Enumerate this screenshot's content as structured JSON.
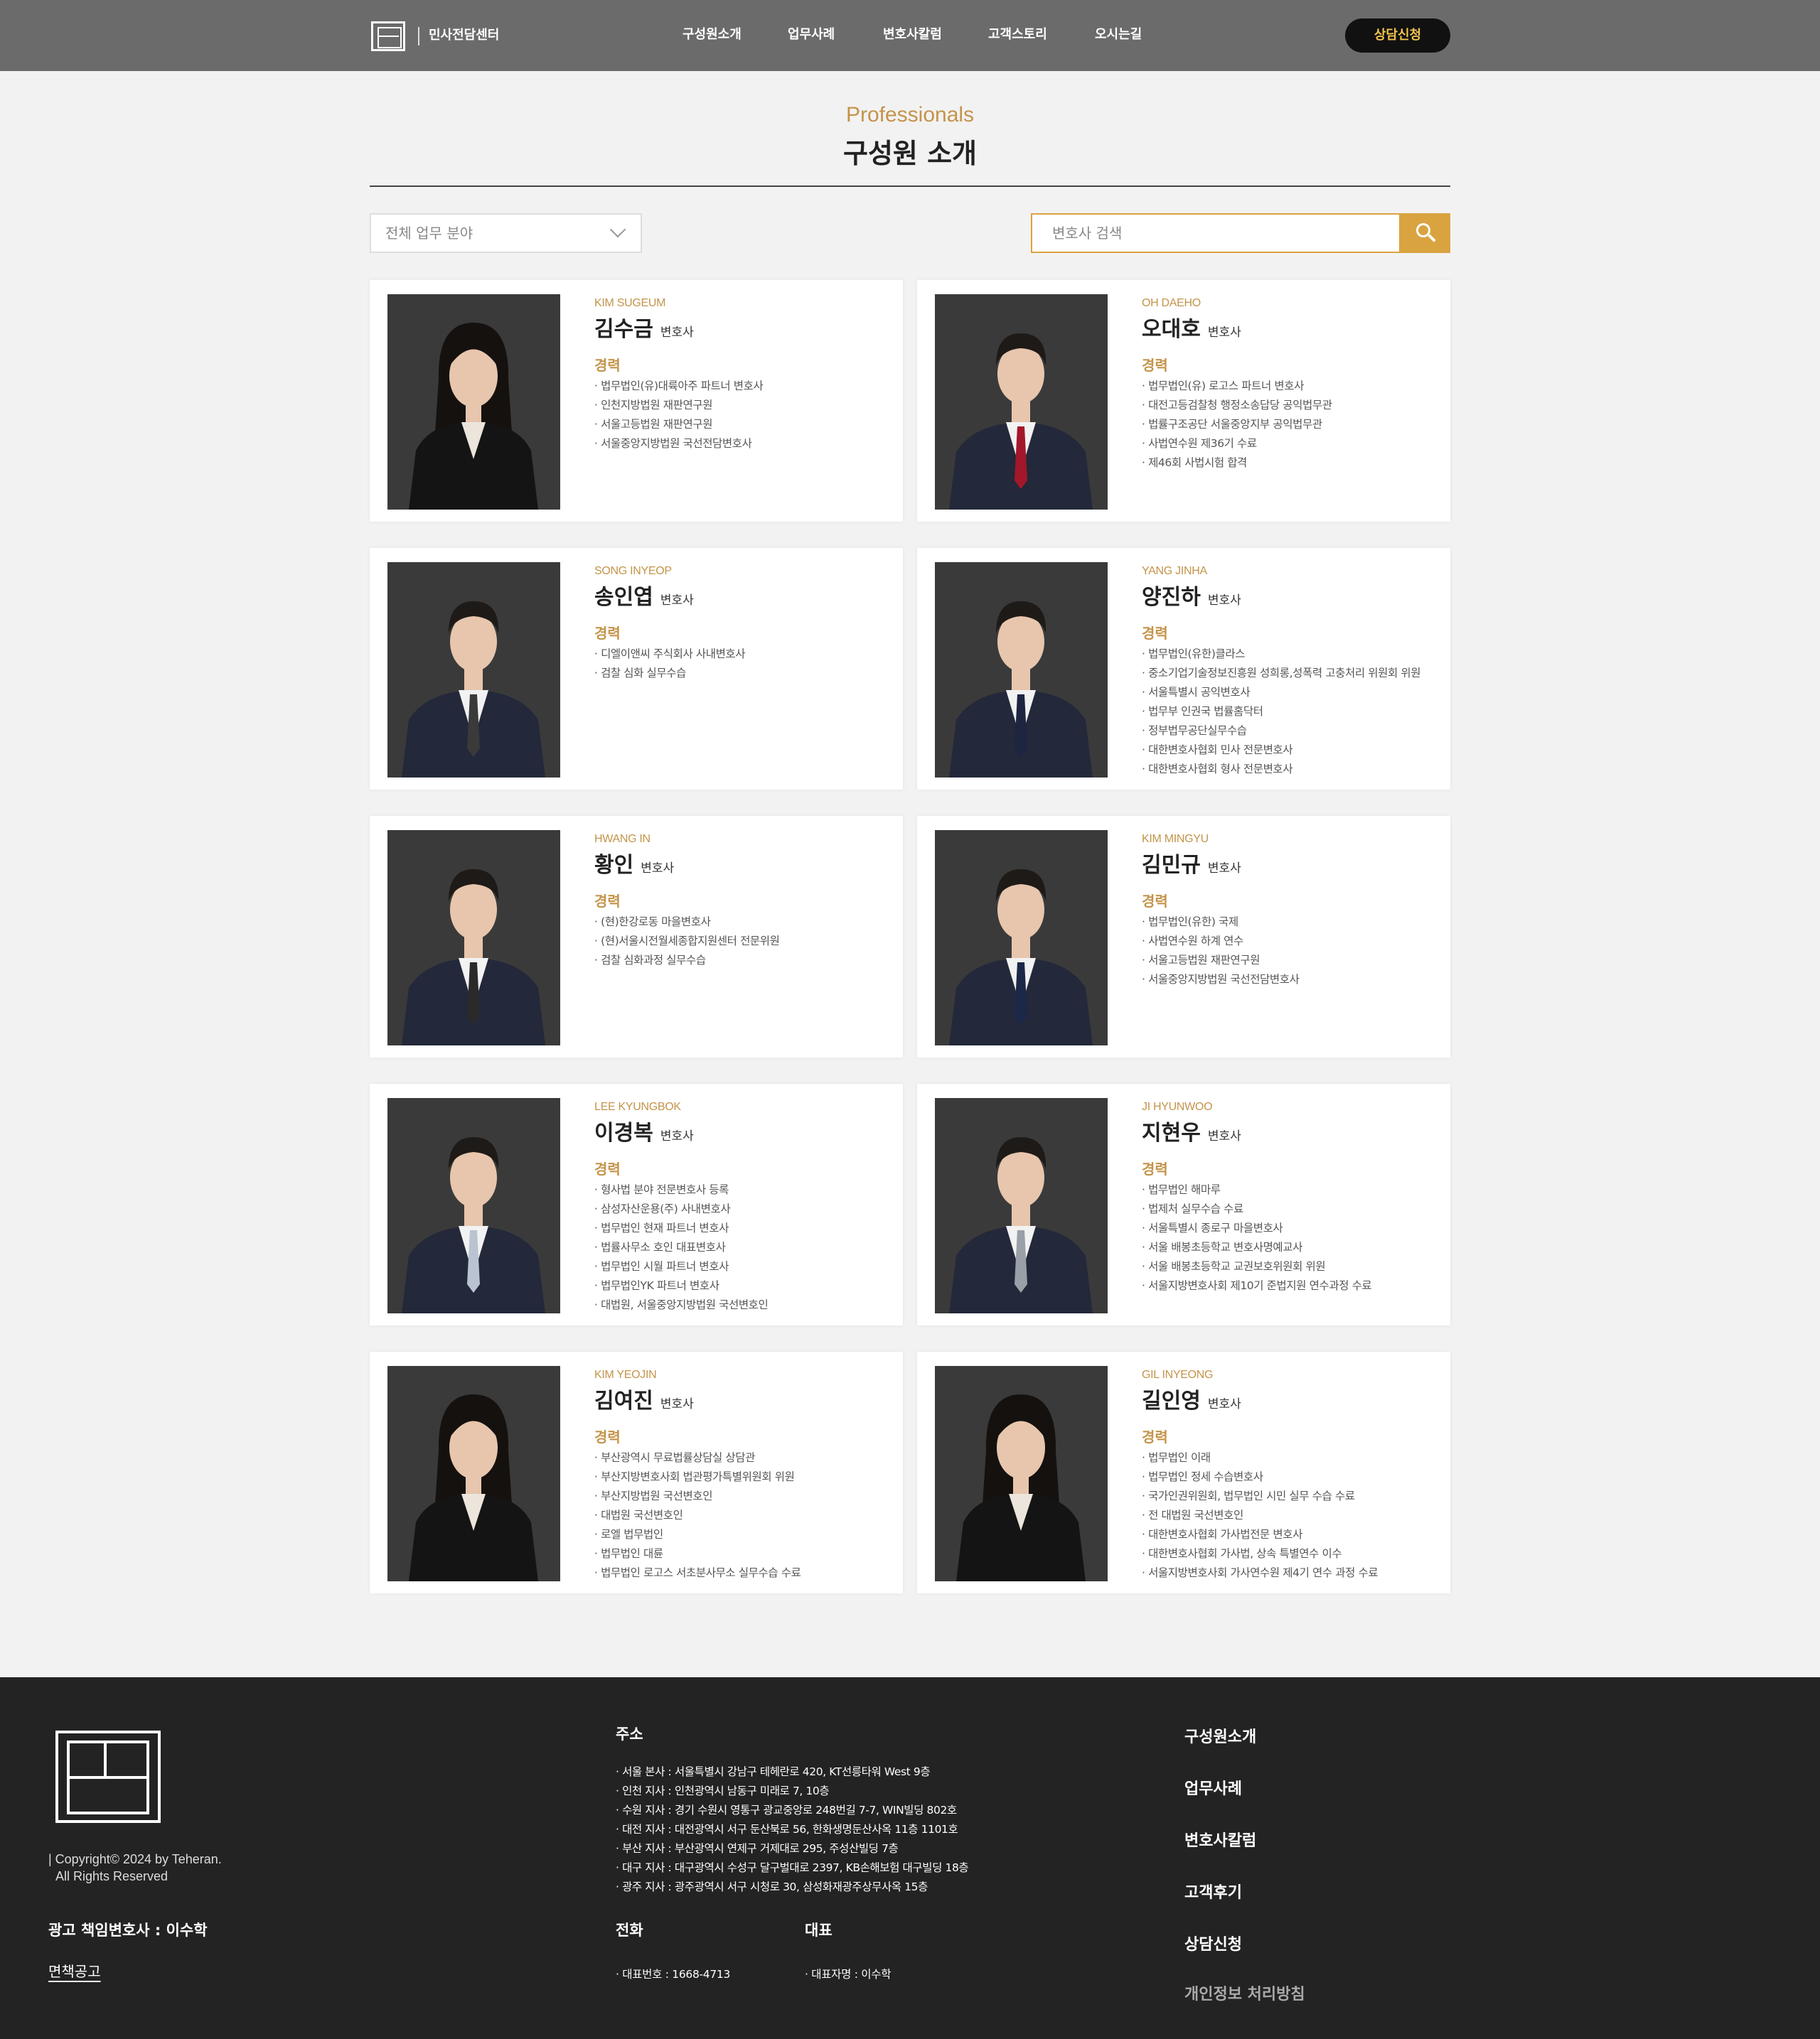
{
  "header": {
    "logo_text": "민사전담센터",
    "nav": [
      "구성원소개",
      "업무사례",
      "변호사칼럼",
      "고객스토리",
      "오시는길"
    ],
    "cta": "상담신청"
  },
  "intro": {
    "eyebrow": "Professionals",
    "title": "구성원 소개"
  },
  "filters": {
    "select_value": "전체 업무 분야",
    "search_placeholder": "변호사 검색"
  },
  "career_label": "경력",
  "role_label": "변호사",
  "lawyers": [
    {
      "eng": "KIM SUGEUM",
      "name": "김수금",
      "gender": "f",
      "tie": "none",
      "career": [
        "법무법인(유)대륙아주 파트너 변호사",
        "인천지방법원 재판연구원",
        "서울고등법원 재판연구원",
        "서울중앙지방법원 국선전담변호사"
      ]
    },
    {
      "eng": "OH DAEHO",
      "name": "오대호",
      "gender": "m",
      "tie": "#a3172a",
      "career": [
        "법무법인(유) 로고스 파트너 변호사",
        "대전고등검찰청 행정소송답당 공익법무관",
        "법률구조공단 서울중앙지부 공익법무관",
        "사법연수원 제36기 수료",
        "제46회 사법시험 합격"
      ]
    },
    {
      "eng": "SONG INYEOP",
      "name": "송인엽",
      "gender": "m",
      "tie": "#3a3a3a",
      "career": [
        "디엘이앤씨 주식회사 사내변호사",
        "검찰 심화 실무수습"
      ]
    },
    {
      "eng": "YANG JINHA",
      "name": "양진하",
      "gender": "m",
      "tie": "#1d2540",
      "career": [
        "법무법인(유한)클라스",
        "중소기업기술정보진흥원 성희롱,성폭력 고충처리 위원회 위원",
        "서울특별시 공익변호사",
        "법무부 인권국 법률홈닥터",
        "정부법무공단실무수습",
        "대한변호사협회 민사 전문변호사",
        "대한변호사협회 형사 전문변호사"
      ]
    },
    {
      "eng": "HWANG IN",
      "name": "황인",
      "gender": "m",
      "tie": "#2a2a2a",
      "career": [
        "(현)한강로동 마을변호사",
        "(현)서울시전월세종합지원센터 전문위원",
        "검찰 심화과정 실무수습"
      ]
    },
    {
      "eng": "KIM MINGYU",
      "name": "김민규",
      "gender": "m",
      "tie": "#1b2848",
      "career": [
        "법무법인(유한) 국제",
        "사법연수원 하계 연수",
        "서울고등법원 재판연구원",
        "서울중앙지방법원 국선전담변호사"
      ]
    },
    {
      "eng": "LEE KYUNGBOK",
      "name": "이경복",
      "gender": "m",
      "tie": "#b9c4d0",
      "career": [
        "형사법 분야 전문변호사 등록",
        "삼성자산운용(주) 사내변호사",
        "법무법인 현재 파트너 변호사",
        "법률사무소 호인 대표변호사",
        "법무법인 시월 파트너 변호사",
        "법무법인YK 파트너 변호사",
        "대법원, 서울중앙지방법원 국선변호인"
      ]
    },
    {
      "eng": "JI HYUNWOO",
      "name": "지현우",
      "gender": "m",
      "tie": "#9aa0a8",
      "career": [
        "법무법인 해마루",
        "법제처 실무수습 수료",
        "서울특별시 종로구 마을변호사",
        "서울 배봉초등학교 변호사명예교사",
        "서울 배봉초등학교 교권보호위원회 위원",
        "서울지방변호사회 제10기 준법지원 연수과정 수료"
      ]
    },
    {
      "eng": "KIM YEOJIN",
      "name": "김여진",
      "gender": "f",
      "tie": "none",
      "career": [
        "부산광역시 무료법률상담실 상담관",
        "부산지방변호사회 법관평가특별위원회 위원",
        "부산지방법원 국선변호인",
        "대법원 국선변호인",
        "로엘 법무법인",
        "법무법인 대륜",
        "법무법인 로고스 서초분사무소 실무수습 수료"
      ]
    },
    {
      "eng": "GIL INYEONG",
      "name": "길인영",
      "gender": "f",
      "tie": "none",
      "career": [
        "법무법인 이래",
        "법무법인 정세 수습변호사",
        "국가인권위원회, 법무법인 시민 실무 수습 수료",
        "전 대법원 국선변호인",
        "대한변호사협회 가사법전문 변호사",
        "대한변호사협회 가사법, 상속 특별연수 이수",
        "서울지방변호사회 가사연수원 제4기 연수 과정 수료"
      ]
    }
  ],
  "footer": {
    "copyright_1": "| Copyright© 2024 by Teheran.",
    "copyright_2": "All Rights Reserved",
    "ad_lawyer": "광고 책임변호사 : 이수학",
    "disclaimer": "면책공고",
    "address_heading": "주소",
    "addresses": [
      "서울 본사 : 서울특별시 강남구 테헤란로 420, KT선릉타워 West 9층",
      "인천 지사 : 인천광역시 남동구 미래로 7, 10층",
      "수원 지사 : 경기 수원시 영통구 광교중앙로 248번길 7-7, WIN빌딩 802호",
      "대전 지사 : 대전광역시 서구 둔산북로 56, 한화생명둔산사옥 11층 1101호",
      "부산 지사 : 부산광역시 연제구 거제대로 295, 주성산빌딩 7층",
      "대구 지사 : 대구광역시 수성구 달구벌대로 2397, KB손해보험 대구빌딩 18층",
      "광주 지사 : 광주광역시 서구 시청로 30, 삼성화재광주상무사옥 15층"
    ],
    "phone_heading": "전화",
    "phone": "· 대표번호 : 1668-4713",
    "rep_heading": "대표",
    "rep": "· 대표자명 : 이수학",
    "nav": [
      "구성원소개",
      "업무사례",
      "변호사칼럼",
      "고객후기",
      "상담신청"
    ],
    "privacy": "개인정보 처리방침"
  }
}
